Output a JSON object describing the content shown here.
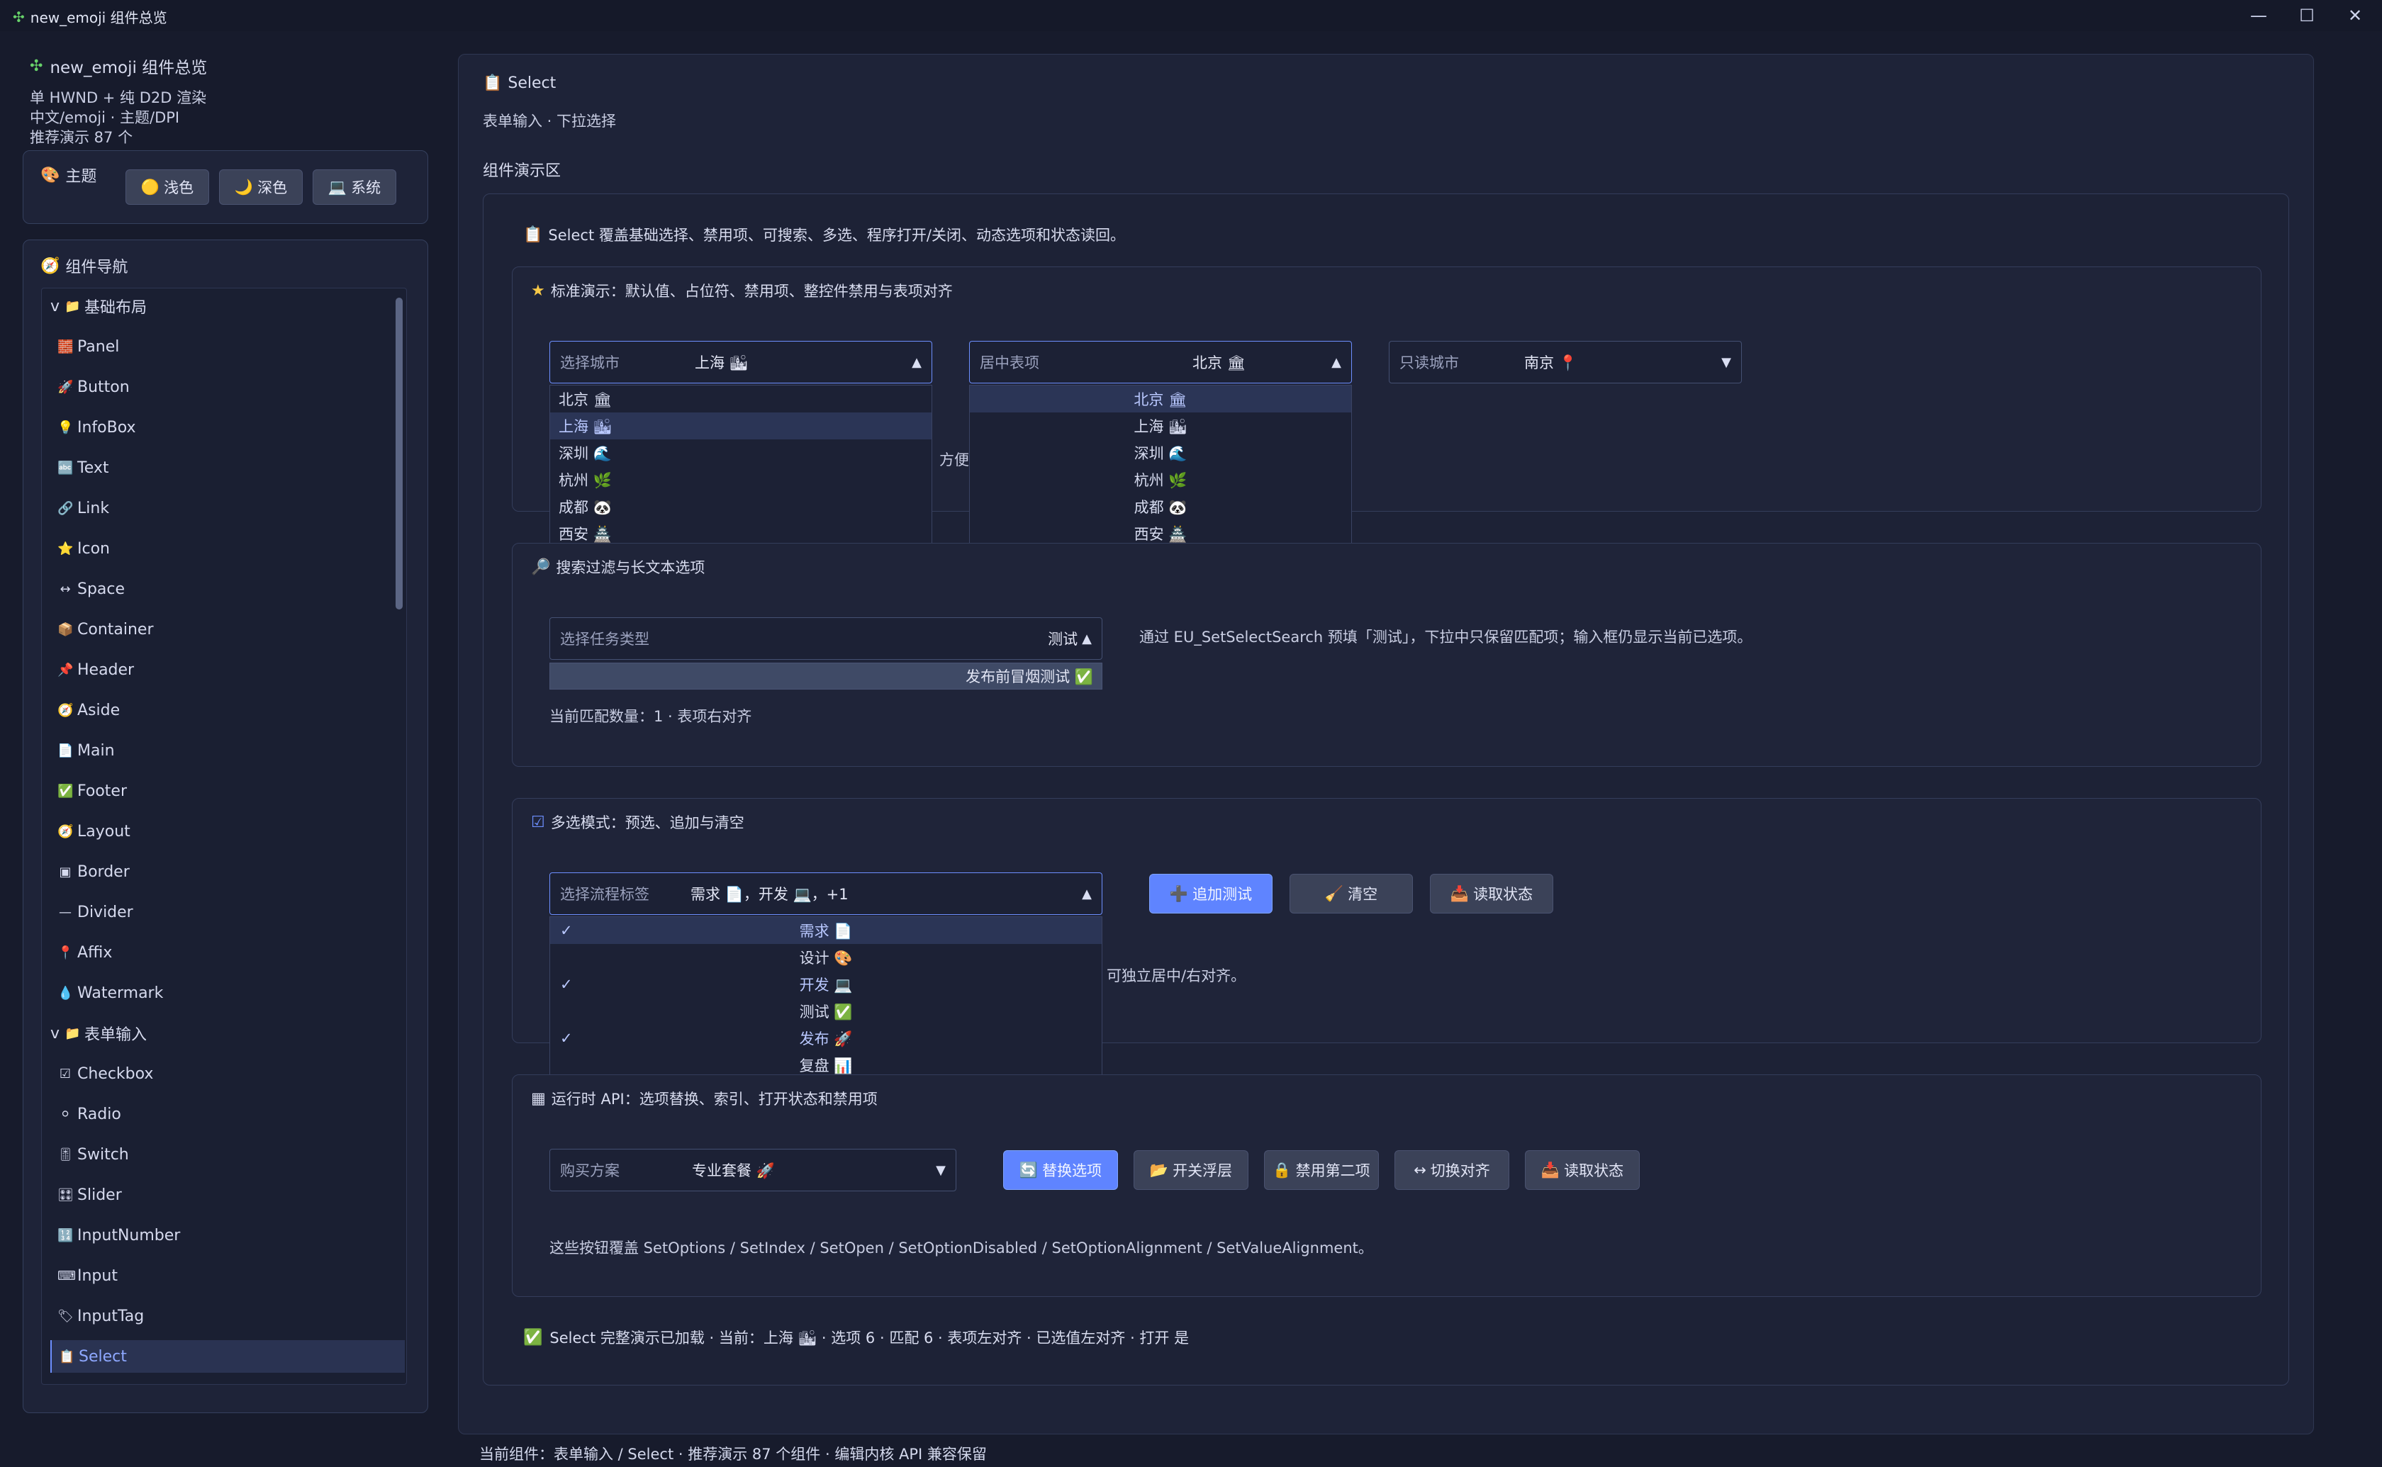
{
  "window": {
    "title": "new_emoji 组件总览",
    "title_icon": "✣",
    "controls": [
      "—",
      "☐",
      "✕"
    ]
  },
  "left": {
    "app_title": "new_emoji 组件总览",
    "subtitle_lines": [
      "单 HWND + 纯 D2D 渲染",
      "中文/emoji · 主题/DPI",
      "推荐演示 87 个"
    ],
    "theme": {
      "title": "主题",
      "buttons": [
        {
          "label": "浅色",
          "icon": "🟡"
        },
        {
          "label": "深色",
          "icon": "🌙"
        },
        {
          "label": "系统",
          "icon": "💻"
        }
      ]
    },
    "nav": {
      "title": "组件导航",
      "items": [
        {
          "label": "基础布局",
          "icon": "📁",
          "group": true,
          "expander": "v"
        },
        {
          "label": "Panel",
          "icon": "🧱",
          "group": false
        },
        {
          "label": "Button",
          "icon": "🚀",
          "group": false
        },
        {
          "label": "InfoBox",
          "icon": "💡",
          "group": false
        },
        {
          "label": "Text",
          "icon": "🔤",
          "group": false
        },
        {
          "label": "Link",
          "icon": "🔗",
          "group": false
        },
        {
          "label": "Icon",
          "icon": "⭐",
          "group": false
        },
        {
          "label": "Space",
          "icon": "↔",
          "group": false
        },
        {
          "label": "Container",
          "icon": "📦",
          "group": false
        },
        {
          "label": "Header",
          "icon": "📌",
          "group": false
        },
        {
          "label": "Aside",
          "icon": "🧭",
          "group": false
        },
        {
          "label": "Main",
          "icon": "📄",
          "group": false
        },
        {
          "label": "Footer",
          "icon": "✅",
          "group": false
        },
        {
          "label": "Layout",
          "icon": "🧭",
          "group": false
        },
        {
          "label": "Border",
          "icon": "▣",
          "group": false
        },
        {
          "label": "Divider",
          "icon": "—",
          "group": false
        },
        {
          "label": "Affix",
          "icon": "📍",
          "group": false
        },
        {
          "label": "Watermark",
          "icon": "💧",
          "group": false
        },
        {
          "label": "表单输入",
          "icon": "📁",
          "group": true,
          "expander": "v"
        },
        {
          "label": "Checkbox",
          "icon": "☑",
          "group": false
        },
        {
          "label": "Radio",
          "icon": "⚪",
          "group": false
        },
        {
          "label": "Switch",
          "icon": "🎚",
          "group": false
        },
        {
          "label": "Slider",
          "icon": "🎛",
          "group": false
        },
        {
          "label": "InputNumber",
          "icon": "🔢",
          "group": false
        },
        {
          "label": "Input",
          "icon": "⌨",
          "group": false
        },
        {
          "label": "InputTag",
          "icon": "🏷",
          "group": false
        },
        {
          "label": "Select",
          "icon": "📋",
          "group": false,
          "selected": true
        }
      ]
    }
  },
  "main": {
    "header": {
      "icon": "📋",
      "title": "Select",
      "subtitle": "表单输入 · 下拉选择"
    },
    "demo_area_title": "组件演示区",
    "intro": {
      "icon": "📋",
      "text": "Select 覆盖基础选择、禁用项、可搜索、多选、程序打开/关闭、动态选项和状态读回。"
    },
    "standard": {
      "icon": "★",
      "title": "标准演示：默认值、占位符、禁用项、整控件禁用与表项对齐",
      "select1": {
        "placeholder": "选择城市",
        "value": "上海 🏙"
      },
      "select2": {
        "placeholder": "居中表项",
        "value": "北京 🏛"
      },
      "select3": {
        "placeholder": "只读城市",
        "value": "南京 📍"
      },
      "dropdown1": [
        "北京 🏛",
        "上海 🏙",
        "深圳 🌊",
        "杭州 🌿",
        "成都 🐼",
        "西安 🏯"
      ],
      "dropdown2": [
        "北京 🏛",
        "上海 🏙",
        "深圳 🌊",
        "杭州 🌿",
        "成都 🐼",
        "西安 🏯"
      ],
      "hidden_text": "方便"
    },
    "search": {
      "icon": "🔎",
      "title": "搜索过滤与长文本选项",
      "placeholder": "选择任务类型",
      "value": "测试",
      "option": "发布前冒烟测试 ✅",
      "desc": "通过 EU_SetSelectSearch 预填「测试」，下拉中只保留匹配项；输入框仍显示当前已选项。",
      "match": "当前匹配数量：1 · 表项右对齐"
    },
    "multi": {
      "icon": "☑",
      "title": "多选模式：预选、追加与清空",
      "placeholder": "选择流程标签",
      "value": "需求 📄，开发 💻，+1",
      "buttons": [
        {
          "label": "追加测试",
          "icon": "➕"
        },
        {
          "label": "清空",
          "icon": "🧹"
        },
        {
          "label": "读取状态",
          "icon": "📥"
        }
      ],
      "items": [
        {
          "label": "需求 📄",
          "checked": true
        },
        {
          "label": "设计 🎨",
          "checked": false
        },
        {
          "label": "开发 💻",
          "checked": true
        },
        {
          "label": "测试 ✅",
          "checked": false
        },
        {
          "label": "发布 🚀",
          "checked": true
        },
        {
          "label": "复盘 📊",
          "checked": false
        }
      ],
      "side_text": "可独立居中/右对齐。"
    },
    "runtime": {
      "icon": "▦",
      "title": "运行时 API：选项替换、索引、打开状态和禁用项",
      "select": {
        "placeholder": "购买方案",
        "value": "专业套餐 🚀"
      },
      "buttons": [
        {
          "label": "替换选项",
          "icon": "🔄"
        },
        {
          "label": "开关浮层",
          "icon": "📂"
        },
        {
          "label": "禁用第二项",
          "icon": "🔒"
        },
        {
          "label": "切换对齐",
          "icon": "↔"
        },
        {
          "label": "读取状态",
          "icon": "📥"
        }
      ],
      "desc": "这些按钮覆盖 SetOptions / SetIndex / SetOpen / SetOptionDisabled / SetOptionAlignment / SetValueAlignment。"
    },
    "status": {
      "icon": "✅",
      "text": "Select 完整演示已加载 · 当前：上海 🏙 · 选项 6 · 匹配 6 · 表项左对齐 · 已选值左对齐 · 打开 是"
    }
  },
  "footer": {
    "text": "当前组件：表单输入 / Select · 推荐演示 87 个组件 · 编辑内核 API 兼容保留"
  }
}
